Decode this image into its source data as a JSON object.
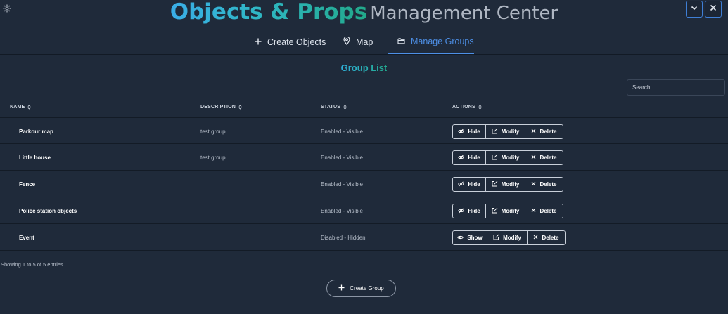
{
  "header": {
    "title_main": "Objects & Props",
    "title_sub": "Management Center"
  },
  "tabs": [
    {
      "label": "Create Objects",
      "icon": "plus-icon"
    },
    {
      "label": "Map",
      "icon": "map-pin-icon"
    },
    {
      "label": "Manage Groups",
      "icon": "folder-icon",
      "active": true
    }
  ],
  "section_title": "Group List",
  "search": {
    "placeholder": "Search...",
    "value": ""
  },
  "table": {
    "columns": [
      "NAME",
      "DESCRIPTION",
      "STATUS",
      "ACTIONS"
    ],
    "rows": [
      {
        "name": "Parkour map",
        "description": "test group",
        "status": "Enabled - Visible",
        "toggle_label": "Hide",
        "modify_label": "Modify",
        "delete_label": "Delete"
      },
      {
        "name": "Little house",
        "description": "test group",
        "status": "Enabled - Visible",
        "toggle_label": "Hide",
        "modify_label": "Modify",
        "delete_label": "Delete"
      },
      {
        "name": "Fence",
        "description": "",
        "status": "Enabled - Visible",
        "toggle_label": "Hide",
        "modify_label": "Modify",
        "delete_label": "Delete"
      },
      {
        "name": "Police station objects",
        "description": "",
        "status": "Enabled - Visible",
        "toggle_label": "Hide",
        "modify_label": "Modify",
        "delete_label": "Delete"
      },
      {
        "name": "Event",
        "description": "",
        "status": "Disabled - Hidden",
        "toggle_label": "Show",
        "modify_label": "Modify",
        "delete_label": "Delete"
      }
    ]
  },
  "entries_text": "Showing 1 to 5 of 5 entries",
  "create_group_label": "Create Group",
  "colors": {
    "background": "#1f2a3a",
    "accent_blue": "#4d8fe6",
    "title_gradient_start": "#3aaee8",
    "title_gradient_end": "#22a98a"
  }
}
